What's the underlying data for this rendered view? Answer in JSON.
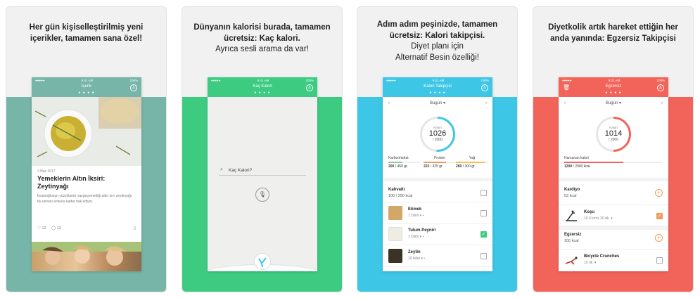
{
  "panels": [
    {
      "caption_bold": "Her gün kişiselleştirilmiş yeni içerikler, tamamen sana özel!",
      "accent": "#76b5a8",
      "status": {
        "carrier": "●●●●●",
        "time": "9:41 AM",
        "battery": "100%"
      },
      "nav_title": "İçerik",
      "nav_dots": "● ● ● ●",
      "profile_icon": "profile-icon",
      "article": {
        "date": "2 Haz 2017",
        "title": "Yemeklerin Altın İksiri: Zeytinyağı",
        "excerpt": "İnsanoğlunun yüzyıllardır vazgeçemediği altın sıvı zeytinyağı bu unvanı sonuna kadar hak ediyor.",
        "likes": "12",
        "comments": "12"
      }
    },
    {
      "caption_bold": "Dünyanın kalorisi burada, tamamen ücretsiz: Kaç kalori.",
      "caption_regular": "Ayrıca sesli arama da var!",
      "accent": "#3dcb82",
      "status": {
        "carrier": "●●●●●",
        "time": "9:41 AM",
        "battery": "100%"
      },
      "nav_title": "Kaç Kalori",
      "nav_dots": "● ● ● ●",
      "search_placeholder": "Kaç Kalori?",
      "mic_icon": "microphone-icon",
      "logo_icon": "brand-logo-icon"
    },
    {
      "caption_bold": "Adım adım peşinizde, tamamen ücretsiz: Kalori takipçisi.",
      "caption_regular": "Diyet planı için Alternatif Besin özelliği!",
      "accent": "#3ec6e6",
      "status": {
        "carrier": "●●●●●",
        "time": "9:41 AM",
        "battery": "100%"
      },
      "nav_title": "Kalori Takipçisi",
      "nav_dots": "● ● ● ●",
      "date_label": "Bugün",
      "ring": {
        "label": "Kalori",
        "value": "1026",
        "goal": "/ 2000",
        "progress": 0.51
      },
      "macros": [
        {
          "name": "Karbonhidrat",
          "value": "200",
          "goal": "/ 450 gr.",
          "color": "#8fc6a3",
          "fill": 0.44
        },
        {
          "name": "Protein",
          "value": "223",
          "goal": "/ 325 gr.",
          "color": "#f29a5c",
          "fill": 0.69
        },
        {
          "name": "Yağ",
          "value": "269",
          "goal": "/ 300 gr.",
          "color": "#f4c24a",
          "fill": 0.9
        }
      ],
      "meal": {
        "name": "Kahvaltı",
        "kcal": "100 / 250 kcal"
      },
      "foods": [
        {
          "name": "Ekmek",
          "sub": "1 Dilim ▾ •",
          "checked": false
        },
        {
          "name": "Tulum Peyniri",
          "sub": "1 Dilim ▾ •",
          "checked": true
        },
        {
          "name": "Zeytin",
          "sub": "10 Adet ▾ •",
          "checked": false
        }
      ]
    },
    {
      "caption_bold": "Diyetkolik artık hareket ettiğin her anda yanında: Egzersiz Takipçisi",
      "accent": "#f2645a",
      "status": {
        "carrier": "●●●●●",
        "time": "9:41 AM",
        "battery": "100%"
      },
      "nav_title": "Egzersiz",
      "nav_dots": "● ● ● ●",
      "date_label": "Bugün",
      "ring": {
        "label": "Kalori",
        "value": "1014",
        "goal": "/ 2000",
        "progress": 0.5
      },
      "burned": {
        "label": "Harcanan kalori",
        "value": "1200",
        "goal": "/ 2000 kcal",
        "fill": 0.6
      },
      "sections": [
        {
          "name": "Kardiyo",
          "kcal": "53 kcal",
          "item": {
            "name": "Koşu",
            "sub": "10.0 km/s 30 dk. ▾",
            "checked": true
          }
        },
        {
          "name": "Egzersiz",
          "kcal": "100 kcal",
          "item": {
            "name": "Bicycle Crunches",
            "sub": "10 dk. ▾",
            "checked": false
          }
        }
      ]
    }
  ]
}
